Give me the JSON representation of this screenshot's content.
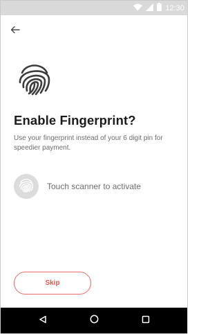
{
  "status_bar": {
    "time": "12:30",
    "icons": [
      "wifi-icon",
      "cellular-signal-icon",
      "battery-icon"
    ]
  },
  "header": {
    "back_icon": "arrow-left-icon"
  },
  "hero": {
    "icon": "fingerprint-icon"
  },
  "content": {
    "title": "Enable Fingerprint?",
    "subtitle": "Use your fingerprint instead of your 6 digit pin for speedier payment."
  },
  "scanner": {
    "icon": "fingerprint-icon",
    "label": "Touch scanner to activate"
  },
  "actions": {
    "skip_label": "Skip"
  },
  "nav_bar": {
    "icons": [
      "back-triangle-icon",
      "home-circle-icon",
      "recents-square-icon"
    ]
  },
  "colors": {
    "accent": "#e4554f",
    "status_bar": "#d9d9d9",
    "nav_bar": "#000000",
    "title_text": "#1c1c1c",
    "body_text": "#6d6d6d",
    "scanner_circle": "#dcdcdc"
  }
}
